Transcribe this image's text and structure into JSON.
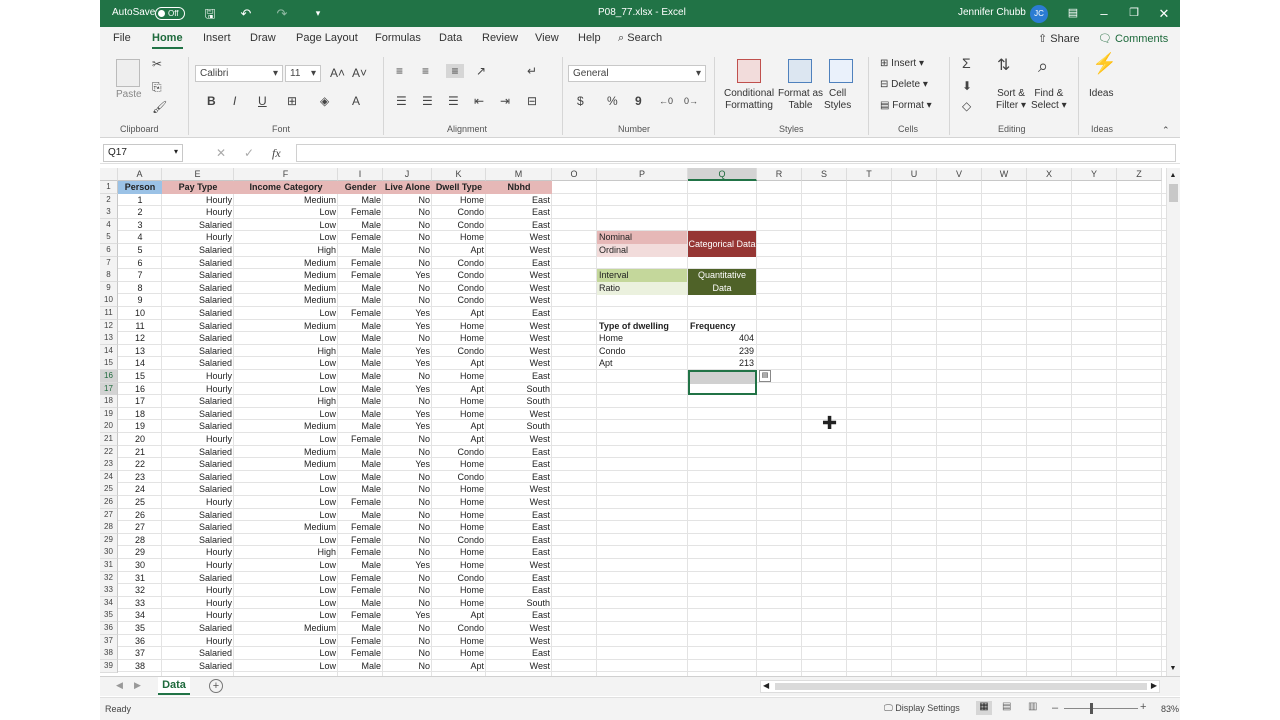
{
  "title_bar": {
    "autosave_label": "AutoSave",
    "autosave_state": "Off",
    "filename": "P08_77.xlsx",
    "app_name": "Excel",
    "user_name": "Jennifer Chubb",
    "user_initials": "JC"
  },
  "menu": {
    "items": [
      "File",
      "Home",
      "Insert",
      "Draw",
      "Page Layout",
      "Formulas",
      "Data",
      "Review",
      "View",
      "Help"
    ],
    "search_label": "Search",
    "share_label": "Share",
    "comments_label": "Comments"
  },
  "ribbon": {
    "paste_label": "Paste",
    "clipboard_label": "Clipboard",
    "font_name": "Calibri",
    "font_size": "11",
    "font_label": "Font",
    "alignment_label": "Alignment",
    "number_format": "General",
    "number_label": "Number",
    "conditional_formatting": "Conditional",
    "conditional_formatting_2": "Formatting",
    "format_as_table": "Format as",
    "format_as_table_2": "Table",
    "cell_styles": "Cell",
    "cell_styles_2": "Styles",
    "styles_label": "Styles",
    "insert_label": "Insert",
    "delete_label": "Delete",
    "format_label": "Format",
    "cells_label": "Cells",
    "sort_filter": "Sort &",
    "sort_filter_2": "Filter",
    "find_select": "Find &",
    "find_select_2": "Select",
    "editing_label": "Editing",
    "ideas_button": "Ideas",
    "ideas_label": "Ideas",
    "bold": "B",
    "italic": "I",
    "underline": "U",
    "currency": "$",
    "percent": "%",
    "comma": "9"
  },
  "formula_bar": {
    "name_box": "Q17",
    "fx_label": "fx",
    "formula": ""
  },
  "columns": [
    "A",
    "E",
    "F",
    "I",
    "J",
    "K",
    "M",
    "O",
    "P",
    "Q",
    "R",
    "S",
    "T",
    "U",
    "V",
    "W",
    "X",
    "Y",
    "Z"
  ],
  "table_headers": [
    "Person",
    "Pay Type",
    "Income Category",
    "Gender",
    "Live Alone",
    "Dwell Type",
    "Nbhd"
  ],
  "rows": [
    [
      1,
      "Hourly",
      "Medium",
      "Male",
      "No",
      "Home",
      "East"
    ],
    [
      2,
      "Hourly",
      "Low",
      "Female",
      "No",
      "Condo",
      "East"
    ],
    [
      3,
      "Salaried",
      "Low",
      "Male",
      "No",
      "Condo",
      "East"
    ],
    [
      4,
      "Hourly",
      "Low",
      "Female",
      "No",
      "Home",
      "West"
    ],
    [
      5,
      "Salaried",
      "High",
      "Male",
      "No",
      "Apt",
      "West"
    ],
    [
      6,
      "Salaried",
      "Medium",
      "Female",
      "No",
      "Condo",
      "East"
    ],
    [
      7,
      "Salaried",
      "Medium",
      "Female",
      "Yes",
      "Condo",
      "West"
    ],
    [
      8,
      "Salaried",
      "Medium",
      "Male",
      "No",
      "Condo",
      "West"
    ],
    [
      9,
      "Salaried",
      "Medium",
      "Male",
      "No",
      "Condo",
      "West"
    ],
    [
      10,
      "Salaried",
      "Low",
      "Female",
      "Yes",
      "Apt",
      "East"
    ],
    [
      11,
      "Salaried",
      "Medium",
      "Male",
      "Yes",
      "Home",
      "West"
    ],
    [
      12,
      "Salaried",
      "Low",
      "Male",
      "No",
      "Home",
      "West"
    ],
    [
      13,
      "Salaried",
      "High",
      "Male",
      "Yes",
      "Condo",
      "West"
    ],
    [
      14,
      "Salaried",
      "Low",
      "Male",
      "Yes",
      "Apt",
      "West"
    ],
    [
      15,
      "Hourly",
      "Low",
      "Male",
      "No",
      "Home",
      "East"
    ],
    [
      16,
      "Hourly",
      "Low",
      "Male",
      "Yes",
      "Apt",
      "South"
    ],
    [
      17,
      "Salaried",
      "High",
      "Male",
      "No",
      "Home",
      "South"
    ],
    [
      18,
      "Salaried",
      "Low",
      "Male",
      "Yes",
      "Home",
      "West"
    ],
    [
      19,
      "Salaried",
      "Medium",
      "Male",
      "Yes",
      "Apt",
      "South"
    ],
    [
      20,
      "Hourly",
      "Low",
      "Female",
      "No",
      "Apt",
      "West"
    ],
    [
      21,
      "Salaried",
      "Medium",
      "Male",
      "No",
      "Condo",
      "East"
    ],
    [
      22,
      "Salaried",
      "Medium",
      "Male",
      "Yes",
      "Home",
      "East"
    ],
    [
      23,
      "Salaried",
      "Low",
      "Male",
      "No",
      "Condo",
      "East"
    ],
    [
      24,
      "Salaried",
      "Low",
      "Male",
      "No",
      "Home",
      "West"
    ],
    [
      25,
      "Hourly",
      "Low",
      "Female",
      "No",
      "Home",
      "West"
    ],
    [
      26,
      "Salaried",
      "Low",
      "Male",
      "No",
      "Home",
      "East"
    ],
    [
      27,
      "Salaried",
      "Medium",
      "Female",
      "No",
      "Home",
      "East"
    ],
    [
      28,
      "Salaried",
      "Low",
      "Female",
      "No",
      "Condo",
      "East"
    ],
    [
      29,
      "Hourly",
      "High",
      "Female",
      "No",
      "Home",
      "East"
    ],
    [
      30,
      "Hourly",
      "Low",
      "Male",
      "Yes",
      "Home",
      "West"
    ],
    [
      31,
      "Salaried",
      "Low",
      "Female",
      "No",
      "Condo",
      "East"
    ],
    [
      32,
      "Hourly",
      "Low",
      "Female",
      "No",
      "Home",
      "East"
    ],
    [
      33,
      "Hourly",
      "Low",
      "Male",
      "No",
      "Home",
      "South"
    ],
    [
      34,
      "Hourly",
      "Low",
      "Female",
      "Yes",
      "Apt",
      "East"
    ],
    [
      35,
      "Salaried",
      "Medium",
      "Male",
      "No",
      "Condo",
      "West"
    ],
    [
      36,
      "Hourly",
      "Low",
      "Female",
      "No",
      "Home",
      "West"
    ],
    [
      37,
      "Salaried",
      "Low",
      "Female",
      "No",
      "Home",
      "East"
    ],
    [
      38,
      "Salaried",
      "Low",
      "Male",
      "No",
      "Apt",
      "West"
    ]
  ],
  "legend": {
    "nominal": "Nominal",
    "ordinal": "Ordinal",
    "categorical": "Categorical Data",
    "interval": "Interval",
    "ratio": "Ratio",
    "quantitative_1": "Quantitative",
    "quantitative_2": "Data"
  },
  "frequency_table": {
    "header_type": "Type of dwelling",
    "header_freq": "Frequency",
    "rows": [
      [
        "Home",
        "404"
      ],
      [
        "Condo",
        "239"
      ],
      [
        "Apt",
        "213"
      ]
    ]
  },
  "sheet_tab": "Data",
  "status": {
    "ready": "Ready",
    "display_settings": "Display Settings",
    "zoom": "83%"
  },
  "colors": {
    "excel_green": "#217346",
    "header_pink": "#e6b8b7",
    "header_blue": "#9bc2e6",
    "nominal_bg": "#e6b8b7",
    "ordinal_bg": "#f2dcdb",
    "categorical_bg": "#963634",
    "interval_bg": "#c4d79b",
    "ratio_bg": "#ebf1de",
    "quantitative_bg": "#4f6228"
  }
}
